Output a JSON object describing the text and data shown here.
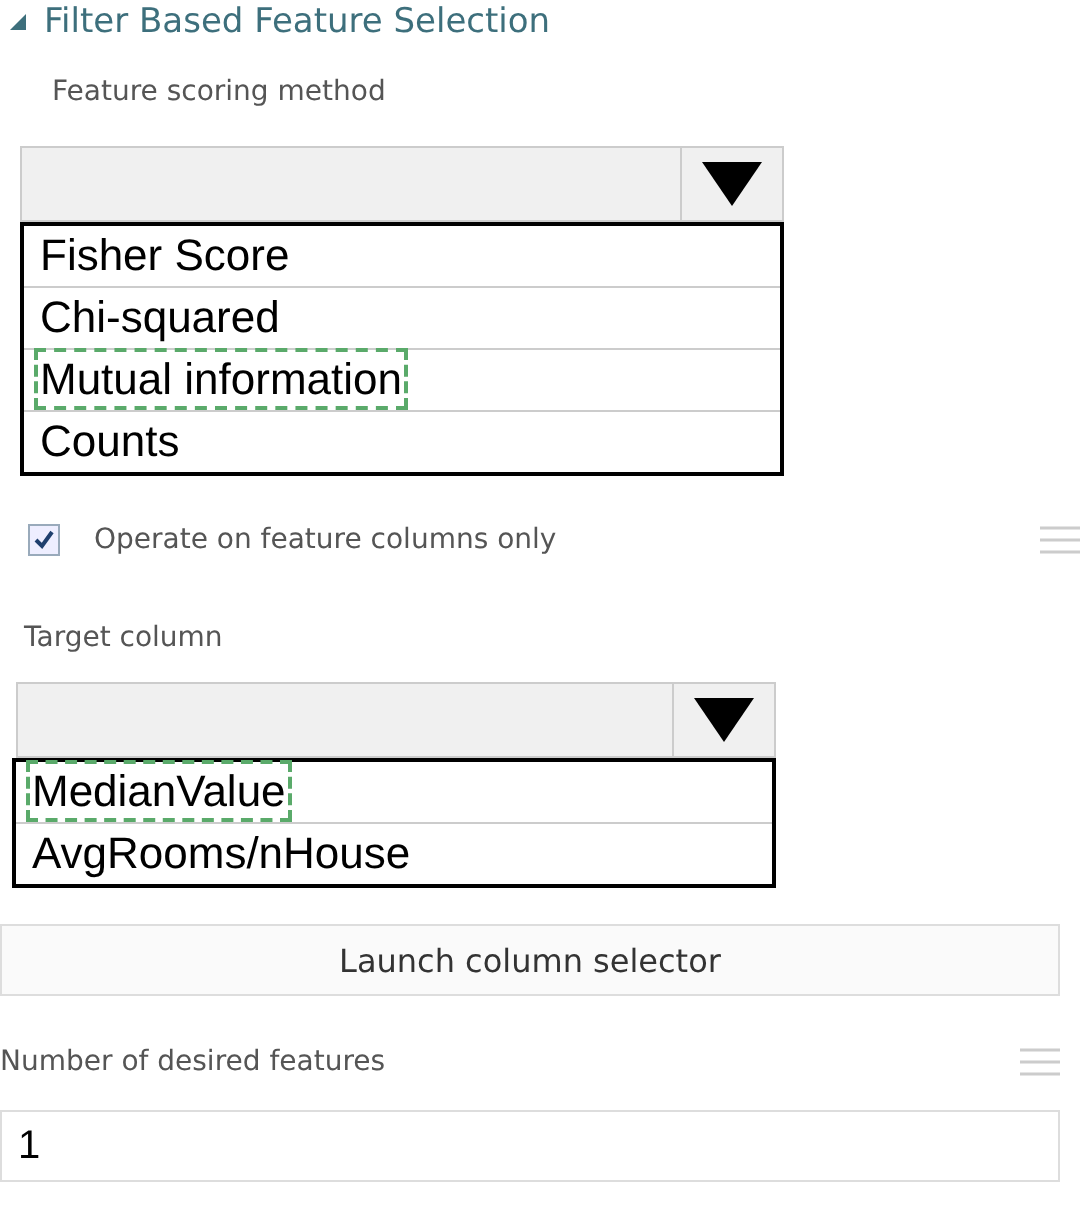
{
  "section": {
    "title": "Filter Based Feature Selection",
    "expanded": true
  },
  "scoring": {
    "label": "Feature scoring method",
    "options": [
      {
        "label": "Fisher Score",
        "outlined": false
      },
      {
        "label": "Chi-squared",
        "outlined": false
      },
      {
        "label": "Mutual information",
        "outlined": true
      },
      {
        "label": "Counts",
        "outlined": false
      }
    ]
  },
  "feature_columns_only": {
    "label": "Operate on feature columns only",
    "checked": true
  },
  "target": {
    "label": "Target column",
    "options": [
      {
        "label": "MedianValue",
        "outlined": true
      },
      {
        "label": "AvgRooms/nHouse",
        "outlined": false
      }
    ]
  },
  "launch_button": "Launch column selector",
  "desired_features": {
    "label": "Number of desired features",
    "value": "1"
  }
}
